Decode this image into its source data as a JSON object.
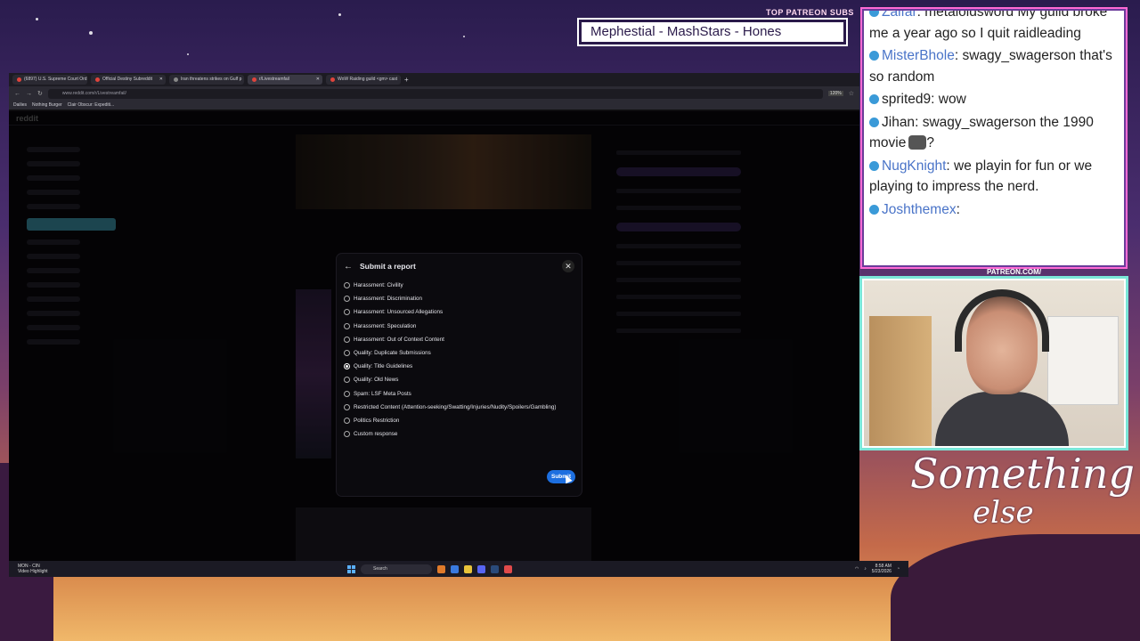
{
  "overlay": {
    "patreon_label": "TOP PATREON SUBS",
    "banner_text": "Mephestial - MashStars - Hones",
    "cam_label": "PATREON.COM/",
    "brand_line1": "Something",
    "brand_line2": "else"
  },
  "browser": {
    "tabs": [
      {
        "label": "(6897) U.S. Supreme Court Ord"
      },
      {
        "label": "Official Destiny Subreddit"
      },
      {
        "label": "Iran threatens strikes on Gulf p"
      },
      {
        "label": "r/Livestreamfail",
        "active": true
      },
      {
        "label": "WoW Raiding guild <gm> cast"
      }
    ],
    "url": "www.reddit.com/r/Livestreamfail/",
    "zoom": "120%",
    "bookmarks": [
      "Dailies",
      "Nothing Burger",
      "Clair Obscur: Expediti..."
    ],
    "site_name": "reddit"
  },
  "modal": {
    "title": "Submit a report",
    "options": [
      {
        "label": "Harassment: Civility",
        "checked": false
      },
      {
        "label": "Harassment: Discrimination",
        "checked": false
      },
      {
        "label": "Harassment: Unsourced Allegations",
        "checked": false
      },
      {
        "label": "Harassment: Speculation",
        "checked": false
      },
      {
        "label": "Harassment: Out of Context Content",
        "checked": false
      },
      {
        "label": "Quality: Duplicate Submissions",
        "checked": false
      },
      {
        "label": "Quality: Title Guidelines",
        "checked": true
      },
      {
        "label": "Quality: Old News",
        "checked": false
      },
      {
        "label": "Spam: LSF Meta Posts",
        "checked": false
      },
      {
        "label": "Restricted Content (Attention-seeking/Swatting/Injuries/Nudity/Spoilers/Gambling)",
        "checked": false
      },
      {
        "label": "Politics Restriction",
        "checked": false
      },
      {
        "label": "Custom response",
        "checked": false
      }
    ],
    "submit_label": "Submit"
  },
  "taskbar": {
    "widget_line1": "MON - CIN",
    "widget_line2": "Video Highlight",
    "search_placeholder": "Search",
    "time": "8:58 AM",
    "date": "5/23/2026"
  },
  "chat": {
    "messages": [
      {
        "user": "Zaifar",
        "text": "metaloidsword My guild broke me a year ago so I quit raidleading",
        "color": "#4a74c8"
      },
      {
        "user": "MisterBhole",
        "text": "swagy_swagerson that's so random",
        "color": "#4a74c8"
      },
      {
        "user": "sprited9",
        "text": "wow",
        "color": "#222222"
      },
      {
        "user": "Jihan",
        "text": "swagy_swagerson the 1990 movie",
        "color": "#222222",
        "suffix": "?"
      },
      {
        "user": "NugKnight",
        "text": "we playin for fun or we playing to impress the nerd.",
        "color": "#4a74c8"
      },
      {
        "user": "Joshthemex",
        "text": "",
        "color": "#4a74c8"
      }
    ]
  }
}
